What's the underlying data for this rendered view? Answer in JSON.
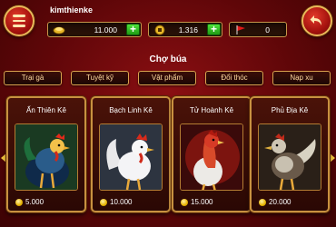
{
  "header": {
    "username": "kimthienke",
    "gold": "11.000",
    "coins": "1.316",
    "flags": "0"
  },
  "title": "Chợ búa",
  "tabs": [
    {
      "label": "Trại gà"
    },
    {
      "label": "Tuyệt kỹ"
    },
    {
      "label": "Vật phẩm"
    },
    {
      "label": "Đổi thóc"
    },
    {
      "label": "Nạp xu"
    }
  ],
  "items": [
    {
      "name": "Ấn Thiên Kê",
      "price": "5.000"
    },
    {
      "name": "Bạch Linh Kê",
      "price": "10.000"
    },
    {
      "name": "Tử Hoành Kê",
      "price": "15.000"
    },
    {
      "name": "Phủ Địa Kê",
      "price": "20.000"
    }
  ],
  "colors": {
    "background": "#6e080b",
    "gold_border": "#c89140",
    "plus_green": "#2fb81f",
    "arrow_yellow": "#f2c53d"
  }
}
